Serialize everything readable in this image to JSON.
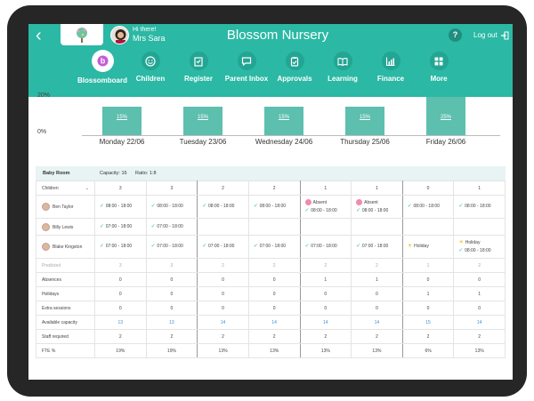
{
  "header": {
    "title": "Blossom Nursery",
    "greeting": "Hi there!",
    "user": "Mrs Sara",
    "help": "?",
    "logout": "Log out"
  },
  "nav": [
    {
      "label": "Blossomboard",
      "icon": "blossom-logo-icon",
      "active": true
    },
    {
      "label": "Children",
      "icon": "smiley-icon"
    },
    {
      "label": "Register",
      "icon": "register-icon"
    },
    {
      "label": "Parent Inbox",
      "icon": "chat-icon"
    },
    {
      "label": "Approvals",
      "icon": "clipboard-check-icon"
    },
    {
      "label": "Learning",
      "icon": "book-icon"
    },
    {
      "label": "Finance",
      "icon": "chart-icon"
    },
    {
      "label": "More",
      "icon": "grid-icon"
    }
  ],
  "chart_data": {
    "type": "bar",
    "categories": [
      "Monday 22/06",
      "Tuesday 23/06",
      "Wednesday 24/06",
      "Thursday 25/06",
      "Friday 26/06"
    ],
    "values": [
      15,
      15,
      15,
      15,
      25
    ],
    "bar_labels": [
      "15%",
      "15%",
      "15%",
      "15%",
      "25%"
    ],
    "ytick_labels": [
      "20%",
      "0%"
    ],
    "ylim": [
      0,
      20
    ]
  },
  "room": {
    "name": "Baby Room",
    "capacity": "Capacity: 16",
    "ratio": "Ratio: 1:8"
  },
  "children_row": {
    "label": "Children",
    "values": [
      "3",
      "3",
      "2",
      "2",
      "1",
      "1",
      "0",
      "1"
    ]
  },
  "children": [
    {
      "name": "Ben Taylor",
      "cells": [
        {
          "type": "session",
          "time": "08:00 - 18:00"
        },
        {
          "type": "session",
          "time": "08:00 - 18:00"
        },
        {
          "type": "session",
          "time": "08:00 - 18:00"
        },
        {
          "type": "session",
          "time": "08:00 - 18:00"
        },
        {
          "type": "absent",
          "status": "Absent",
          "time": "08:00 - 18:00"
        },
        {
          "type": "absent",
          "status": "Absent",
          "time": "08:00 - 18:00"
        },
        {
          "type": "session",
          "time": "08:00 - 18:00"
        },
        {
          "type": "session",
          "time": "08:00 - 18:00"
        }
      ]
    },
    {
      "name": "Billy Lewis",
      "cells": [
        {
          "type": "session",
          "time": "07:00 - 18:00"
        },
        {
          "type": "session",
          "time": "07:00 - 18:00"
        },
        {
          "type": "empty"
        },
        {
          "type": "empty"
        },
        {
          "type": "empty"
        },
        {
          "type": "empty"
        },
        {
          "type": "empty"
        },
        {
          "type": "empty"
        }
      ]
    },
    {
      "name": "Blake Kingston",
      "cells": [
        {
          "type": "session",
          "time": "07:00 - 18:00"
        },
        {
          "type": "session",
          "time": "07:00 - 18:00"
        },
        {
          "type": "session",
          "time": "07:00 - 18:00"
        },
        {
          "type": "session",
          "time": "07:00 - 18:00"
        },
        {
          "type": "session",
          "time": "07:00 - 18:00"
        },
        {
          "type": "session",
          "time": "07:00 - 18:00"
        },
        {
          "type": "holiday",
          "status": "Holiday"
        },
        {
          "type": "holiday",
          "status": "Holiday",
          "time": "08:00 - 18:00"
        }
      ]
    }
  ],
  "stats": [
    {
      "label": "Predicted",
      "values": [
        "3",
        "3",
        "2",
        "2",
        "2",
        "2",
        "1",
        "2"
      ],
      "style": "grey"
    },
    {
      "label": "Absences",
      "values": [
        "0",
        "0",
        "0",
        "0",
        "1",
        "1",
        "0",
        "0"
      ]
    },
    {
      "label": "Holidays",
      "values": [
        "0",
        "0",
        "0",
        "0",
        "0",
        "0",
        "1",
        "1"
      ]
    },
    {
      "label": "Extra sessions",
      "values": [
        "0",
        "0",
        "0",
        "0",
        "0",
        "0",
        "0",
        "0"
      ]
    },
    {
      "label": "Available capacity",
      "values": [
        "13",
        "13",
        "14",
        "14",
        "14",
        "14",
        "15",
        "14"
      ],
      "style": "blue"
    },
    {
      "label": "Staff required",
      "values": [
        "2",
        "2",
        "2",
        "2",
        "2",
        "2",
        "2",
        "2"
      ]
    },
    {
      "label": "FTE %",
      "values": [
        "19%",
        "19%",
        "13%",
        "13%",
        "13%",
        "13%",
        "6%",
        "13%"
      ]
    }
  ]
}
